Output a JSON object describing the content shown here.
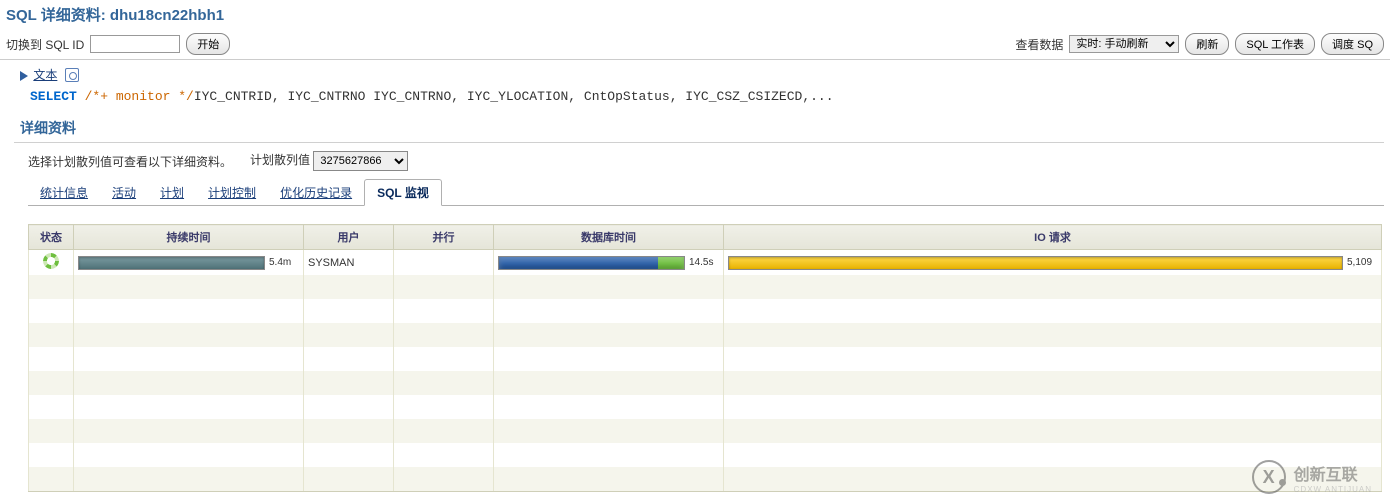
{
  "page": {
    "title_prefix": "SQL 详细资料: ",
    "sql_id": "dhu18cn22hbh1"
  },
  "toolbar": {
    "switch_label": "切换到 SQL ID",
    "go_label": "开始",
    "view_data_label": "查看数据",
    "view_data_option": "实时: 手动刷新",
    "refresh_label": "刷新",
    "sql_worksheet_label": "SQL 工作表",
    "schedule_label": "调度 SQ"
  },
  "text_link": "文本",
  "sql": {
    "select": "SELECT ",
    "comment": "/*+ monitor */",
    "rest": "IYC_CNTRID, IYC_CNTRNO IYC_CNTRNO, IYC_YLOCATION, CntOpStatus, IYC_CSZ_CSIZECD,..."
  },
  "details": {
    "header": "详细资料",
    "hash_hint": "选择计划散列值可查看以下详细资料。",
    "hash_label": "计划散列值",
    "hash_value": "3275627866"
  },
  "tabs": {
    "stats": "统计信息",
    "activity": "活动",
    "plan": "计划",
    "plan_control": "计划控制",
    "tuning_history": "优化历史记录",
    "sql_monitor": "SQL 监视"
  },
  "monitor": {
    "cols": {
      "status": "状态",
      "duration": "持续时间",
      "user": "用户",
      "parallel": "并行",
      "dbtime": "数据库时间",
      "io": "IO 请求"
    },
    "row": {
      "duration_val": "5.4m",
      "user": "SYSMAN",
      "dbtime_val": "14.5s",
      "io_val": "5,109"
    }
  },
  "watermark": {
    "logo": "X",
    "text": "创新互联",
    "sub": "CDXW ANTIJUAN"
  }
}
